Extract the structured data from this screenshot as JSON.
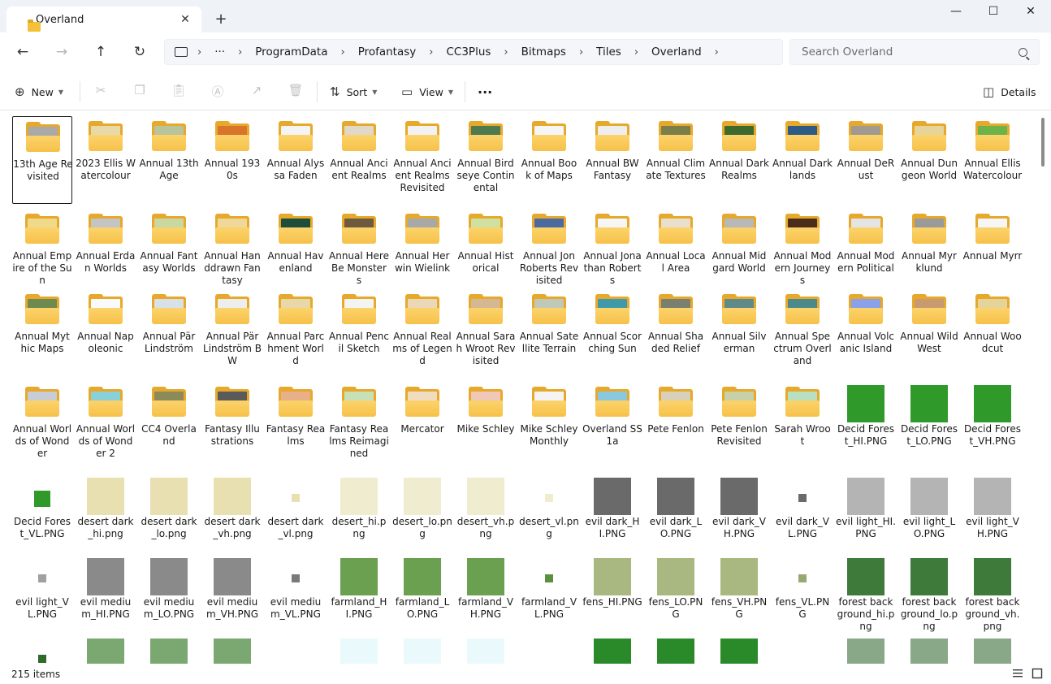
{
  "window": {
    "tab_title": "Overland",
    "tab_close": "✕",
    "new_tab": "+",
    "minimize": "—",
    "maximize": "☐",
    "close": "✕"
  },
  "nav": {
    "back": "←",
    "forward": "→",
    "up": "↑",
    "refresh": "↻",
    "more": "···",
    "breadcrumbs": [
      "ProgramData",
      "Profantasy",
      "CC3Plus",
      "Bitmaps",
      "Tiles",
      "Overland"
    ],
    "separator": "›",
    "search_placeholder": "Search Overland"
  },
  "toolbar": {
    "new_label": "New",
    "sort_label": "Sort",
    "view_label": "View",
    "more_label": "···",
    "details_label": "Details"
  },
  "items": [
    {
      "label": "13th Age Revisited",
      "kind": "folder",
      "color": "#a9a9a9",
      "selected": true
    },
    {
      "label": "2023 Ellis Watercolour",
      "kind": "folder",
      "color": "#e8d9a8"
    },
    {
      "label": "Annual 13thAge",
      "kind": "folder",
      "color": "#b8c49a"
    },
    {
      "label": "Annual 1930s",
      "kind": "folder",
      "color": "#d9742b"
    },
    {
      "label": "Annual Alyssa Faden",
      "kind": "folder",
      "color": "#f4f4f4"
    },
    {
      "label": "Annual Ancient Realms",
      "kind": "folder",
      "color": "#e0d8c8"
    },
    {
      "label": "Annual Ancient Realms Revisited",
      "kind": "folder",
      "color": "#f2f2f2"
    },
    {
      "label": "Annual Birdseye Continental",
      "kind": "folder",
      "color": "#4e7a4e"
    },
    {
      "label": "Annual Book of Maps",
      "kind": "folder",
      "color": "#f6f6f6"
    },
    {
      "label": "Annual BW Fantasy",
      "kind": "folder",
      "color": "#eeeeee"
    },
    {
      "label": "Annual Climate Textures",
      "kind": "folder",
      "color": "#7a7f4a"
    },
    {
      "label": "Annual Dark Realms",
      "kind": "folder",
      "color": "#3e6a2e"
    },
    {
      "label": "Annual Darklands",
      "kind": "folder",
      "color": "#2e5a86"
    },
    {
      "label": "Annual DeRust",
      "kind": "folder",
      "color": "#a09a90"
    },
    {
      "label": "Annual Dungeon World",
      "kind": "folder",
      "color": "#e6d49a"
    },
    {
      "label": "Annual Ellis Watercolour",
      "kind": "folder",
      "color": "#6cb44a"
    },
    {
      "label": "Annual Empire of the Sun",
      "kind": "folder",
      "color": "#f0d98a"
    },
    {
      "label": "Annual Erdan Worlds",
      "kind": "folder",
      "color": "#c4c4c4"
    },
    {
      "label": "Annual Fantasy Worlds",
      "kind": "folder",
      "color": "#c8d8a0"
    },
    {
      "label": "Annual Handdrawn Fantasy",
      "kind": "folder",
      "color": "#efd89a"
    },
    {
      "label": "Annual Havenland",
      "kind": "folder",
      "color": "#1e4e3a"
    },
    {
      "label": "Annual Here Be Monsters",
      "kind": "folder",
      "color": "#6e5a3e"
    },
    {
      "label": "Annual Herwin Wielink",
      "kind": "folder",
      "color": "#a8a8a8"
    },
    {
      "label": "Annual Historical",
      "kind": "folder",
      "color": "#cfe0a0"
    },
    {
      "label": "Annual Jon Roberts Revisited",
      "kind": "folder",
      "color": "#4a6aa0"
    },
    {
      "label": "Annual Jonathan Roberts",
      "kind": "folder",
      "color": "#f6f6f6"
    },
    {
      "label": "Annual Local Area",
      "kind": "folder",
      "color": "#e8e0cc"
    },
    {
      "label": "Annual Midgard World",
      "kind": "folder",
      "color": "#b8b8b8"
    },
    {
      "label": "Annual Modern Journeys",
      "kind": "folder",
      "color": "#4a2e1a"
    },
    {
      "label": "Annual Modern Political",
      "kind": "folder",
      "color": "#e4e4e4"
    },
    {
      "label": "Annual Myrklund",
      "kind": "folder",
      "color": "#9a9a9a"
    },
    {
      "label": "Annual Myrr",
      "kind": "folder",
      "color": "#f6f6f6"
    },
    {
      "label": "Annual Mythic Maps",
      "kind": "folder",
      "color": "#6e8a4e"
    },
    {
      "label": "Annual Napoleonic",
      "kind": "folder",
      "color": "#fafafa"
    },
    {
      "label": "Annual Pär Lindström",
      "kind": "folder",
      "color": "#d8e0e8"
    },
    {
      "label": "Annual Pär Lindström BW",
      "kind": "folder",
      "color": "#eeeeee"
    },
    {
      "label": "Annual Parchment World",
      "kind": "folder",
      "color": "#e6d8a8"
    },
    {
      "label": "Annual Pencil Sketch",
      "kind": "folder",
      "color": "#f4f4f4"
    },
    {
      "label": "Annual Realms of Legend",
      "kind": "folder",
      "color": "#ead8b8"
    },
    {
      "label": "Annual Sarah Wroot Revisited",
      "kind": "folder",
      "color": "#d4b894"
    },
    {
      "label": "Annual Satellite Terrain",
      "kind": "folder",
      "color": "#c0c8b8"
    },
    {
      "label": "Annual Scorching Sun",
      "kind": "folder",
      "color": "#3e9aa8"
    },
    {
      "label": "Annual Shaded Relief",
      "kind": "folder",
      "color": "#7a8070"
    },
    {
      "label": "Annual Silverman",
      "kind": "folder",
      "color": "#5e8a8a"
    },
    {
      "label": "Annual Spectrum Overland",
      "kind": "folder",
      "color": "#4a8a8a"
    },
    {
      "label": "Annual Volcanic Island",
      "kind": "folder",
      "color": "#8aa0e8"
    },
    {
      "label": "Annual Wild West",
      "kind": "folder",
      "color": "#c89a70"
    },
    {
      "label": "Annual Woodcut",
      "kind": "folder",
      "color": "#e4d49a"
    },
    {
      "label": "Annual Worlds of Wonder",
      "kind": "folder",
      "color": "#c8ccd4"
    },
    {
      "label": "Annual Worlds of Wonder 2",
      "kind": "folder",
      "color": "#8ad0d8"
    },
    {
      "label": "CC4 Overland",
      "kind": "folder",
      "color": "#8a8a5a"
    },
    {
      "label": "Fantasy Illustrations",
      "kind": "folder",
      "color": "#5a5a5a"
    },
    {
      "label": "Fantasy Realms",
      "kind": "folder",
      "color": "#e8b088"
    },
    {
      "label": "Fantasy Realms Reimagined",
      "kind": "folder",
      "color": "#c8e0b8"
    },
    {
      "label": "Mercator",
      "kind": "folder",
      "color": "#f0dcc0"
    },
    {
      "label": "Mike Schley",
      "kind": "folder",
      "color": "#f0c8b8"
    },
    {
      "label": "Mike Schley Monthly",
      "kind": "folder",
      "color": "#f4f4f4"
    },
    {
      "label": "Overland SS1a",
      "kind": "folder",
      "color": "#8ac8e0"
    },
    {
      "label": "Pete Fenlon",
      "kind": "folder",
      "color": "#d8d0b8"
    },
    {
      "label": "Pete Fenlon Revisited",
      "kind": "folder",
      "color": "#c8d0a8"
    },
    {
      "label": "Sarah Wroot",
      "kind": "folder",
      "color": "#b8e0c0"
    },
    {
      "label": "Decid Forest_HI.PNG",
      "kind": "image",
      "color": "#2f9a2a",
      "size": "lg"
    },
    {
      "label": "Decid Forest_LO.PNG",
      "kind": "image",
      "color": "#2f9a2a",
      "size": "lg"
    },
    {
      "label": "Decid Forest_VH.PNG",
      "kind": "image",
      "color": "#2f9a2a",
      "size": "lg"
    },
    {
      "label": "Decid Forest_VL.PNG",
      "kind": "image",
      "color": "#2f9a2a",
      "size": "md"
    },
    {
      "label": "desert dark_hi.png",
      "kind": "image",
      "color": "#e8e0b0",
      "size": "lg"
    },
    {
      "label": "desert dark_lo.png",
      "kind": "image",
      "color": "#e8e0b0",
      "size": "lg"
    },
    {
      "label": "desert dark_vh.png",
      "kind": "image",
      "color": "#e8e0b0",
      "size": "lg"
    },
    {
      "label": "desert dark_vl.png",
      "kind": "image",
      "color": "#e8e0b0",
      "size": "sm"
    },
    {
      "label": "desert_hi.png",
      "kind": "image",
      "color": "#f0ecd0",
      "size": "lg"
    },
    {
      "label": "desert_lo.png",
      "kind": "image",
      "color": "#f0ecd0",
      "size": "lg"
    },
    {
      "label": "desert_vh.png",
      "kind": "image",
      "color": "#f0ecd0",
      "size": "lg"
    },
    {
      "label": "desert_vl.png",
      "kind": "image",
      "color": "#f0ecd0",
      "size": "sm"
    },
    {
      "label": "evil dark_HI.PNG",
      "kind": "image",
      "color": "#6a6a6a",
      "size": "lg"
    },
    {
      "label": "evil dark_LO.PNG",
      "kind": "image",
      "color": "#6a6a6a",
      "size": "lg"
    },
    {
      "label": "evil dark_VH.PNG",
      "kind": "image",
      "color": "#6a6a6a",
      "size": "lg"
    },
    {
      "label": "evil dark_VL.PNG",
      "kind": "image",
      "color": "#6a6a6a",
      "size": "sm"
    },
    {
      "label": "evil light_HI.PNG",
      "kind": "image",
      "color": "#b4b4b4",
      "size": "lg"
    },
    {
      "label": "evil light_LO.PNG",
      "kind": "image",
      "color": "#b4b4b4",
      "size": "lg"
    },
    {
      "label": "evil light_VH.PNG",
      "kind": "image",
      "color": "#b4b4b4",
      "size": "lg"
    },
    {
      "label": "evil light_VL.PNG",
      "kind": "image",
      "color": "#a0a0a0",
      "size": "sm"
    },
    {
      "label": "evil medium_HI.PNG",
      "kind": "image",
      "color": "#8a8a8a",
      "size": "lg"
    },
    {
      "label": "evil medium_LO.PNG",
      "kind": "image",
      "color": "#8a8a8a",
      "size": "lg"
    },
    {
      "label": "evil medium_VH.PNG",
      "kind": "image",
      "color": "#8a8a8a",
      "size": "lg"
    },
    {
      "label": "evil medium_VL.PNG",
      "kind": "image",
      "color": "#7a7a7a",
      "size": "sm"
    },
    {
      "label": "farmland_HI.PNG",
      "kind": "image",
      "color": "#6aa050",
      "size": "lg"
    },
    {
      "label": "farmland_LO.PNG",
      "kind": "image",
      "color": "#6aa050",
      "size": "lg"
    },
    {
      "label": "farmland_VH.PNG",
      "kind": "image",
      "color": "#6aa050",
      "size": "lg"
    },
    {
      "label": "farmland_VL.PNG",
      "kind": "image",
      "color": "#5a9040",
      "size": "sm"
    },
    {
      "label": "fens_HI.PNG",
      "kind": "image",
      "color": "#a8b880",
      "size": "lg"
    },
    {
      "label": "fens_LO.PNG",
      "kind": "image",
      "color": "#a8b880",
      "size": "lg"
    },
    {
      "label": "fens_VH.PNG",
      "kind": "image",
      "color": "#a8b880",
      "size": "lg"
    },
    {
      "label": "fens_VL.PNG",
      "kind": "image",
      "color": "#98a870",
      "size": "sm"
    },
    {
      "label": "forest background_hi.png",
      "kind": "image",
      "color": "#3e7a3a",
      "size": "lg"
    },
    {
      "label": "forest background_lo.png",
      "kind": "image",
      "color": "#3e7a3a",
      "size": "lg"
    },
    {
      "label": "forest background_vh.png",
      "kind": "image",
      "color": "#3e7a3a",
      "size": "lg"
    },
    {
      "label": "",
      "kind": "image",
      "color": "#2e6a2a",
      "size": "sm"
    },
    {
      "label": "",
      "kind": "image",
      "color": "#7aa870",
      "size": "lg"
    },
    {
      "label": "",
      "kind": "image",
      "color": "#7aa870",
      "size": "lg"
    },
    {
      "label": "",
      "kind": "image",
      "color": "#7aa870",
      "size": "lg"
    },
    {
      "label": "",
      "kind": "blank"
    },
    {
      "label": "",
      "kind": "image",
      "color": "#eafafc",
      "size": "lg"
    },
    {
      "label": "",
      "kind": "image",
      "color": "#eafafc",
      "size": "lg"
    },
    {
      "label": "",
      "kind": "image",
      "color": "#eafafc",
      "size": "lg"
    },
    {
      "label": "",
      "kind": "blank"
    },
    {
      "label": "",
      "kind": "image",
      "color": "#2a8a2a",
      "size": "lg"
    },
    {
      "label": "",
      "kind": "image",
      "color": "#2a8a2a",
      "size": "lg"
    },
    {
      "label": "",
      "kind": "image",
      "color": "#2a8a2a",
      "size": "lg"
    },
    {
      "label": "",
      "kind": "blank"
    },
    {
      "label": "",
      "kind": "image",
      "color": "#88a888",
      "size": "lg"
    },
    {
      "label": "",
      "kind": "image",
      "color": "#88a888",
      "size": "lg"
    },
    {
      "label": "",
      "kind": "image",
      "color": "#88a888",
      "size": "lg"
    }
  ],
  "status": {
    "count": "215 items"
  }
}
